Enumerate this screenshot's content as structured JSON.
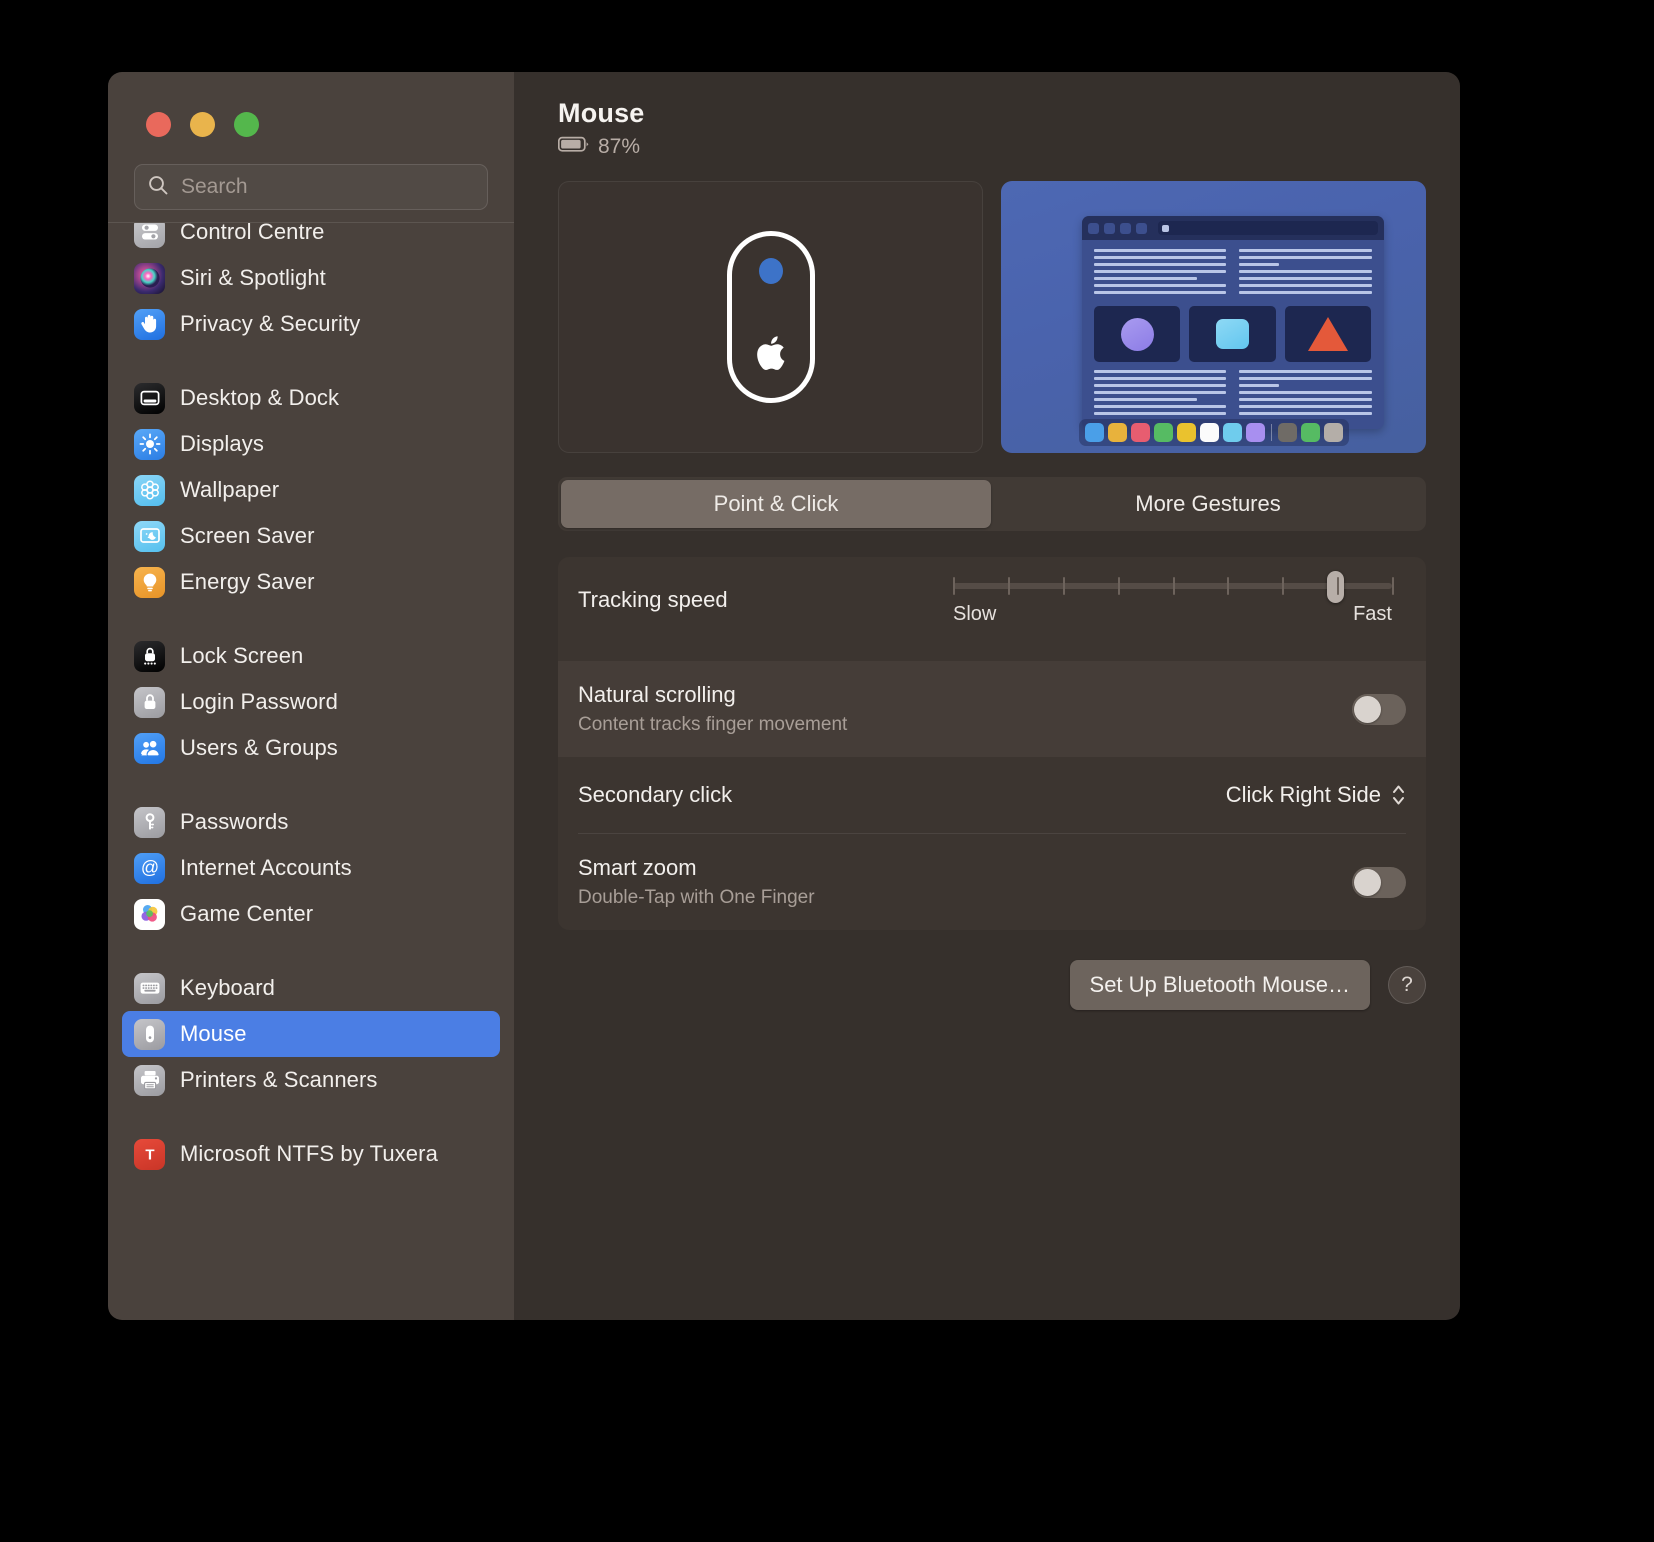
{
  "window": {
    "traffic_lights": [
      "close",
      "minimize",
      "zoom"
    ],
    "colors": {
      "accent": "#4b7ee4",
      "sidebar_bg": "#4a423d",
      "main_bg": "#36302c",
      "card_bg": "#3c3530",
      "close": "#e9695c",
      "minimize": "#e9b44c",
      "maximize": "#54b74c"
    }
  },
  "search": {
    "placeholder": "Search",
    "value": ""
  },
  "sidebar": {
    "groups": [
      {
        "items": [
          {
            "label": "Control Centre",
            "icon": "control-centre-icon",
            "selected": false
          },
          {
            "label": "Siri & Spotlight",
            "icon": "siri-icon",
            "selected": false
          },
          {
            "label": "Privacy & Security",
            "icon": "privacy-security-icon",
            "selected": false
          }
        ]
      },
      {
        "items": [
          {
            "label": "Desktop & Dock",
            "icon": "desktop-dock-icon",
            "selected": false
          },
          {
            "label": "Displays",
            "icon": "displays-icon",
            "selected": false
          },
          {
            "label": "Wallpaper",
            "icon": "wallpaper-icon",
            "selected": false
          },
          {
            "label": "Screen Saver",
            "icon": "screen-saver-icon",
            "selected": false
          },
          {
            "label": "Energy Saver",
            "icon": "energy-saver-icon",
            "selected": false
          }
        ]
      },
      {
        "items": [
          {
            "label": "Lock Screen",
            "icon": "lock-screen-icon",
            "selected": false
          },
          {
            "label": "Login Password",
            "icon": "login-password-icon",
            "selected": false
          },
          {
            "label": "Users & Groups",
            "icon": "users-groups-icon",
            "selected": false
          }
        ]
      },
      {
        "items": [
          {
            "label": "Passwords",
            "icon": "passwords-icon",
            "selected": false
          },
          {
            "label": "Internet Accounts",
            "icon": "internet-accounts-icon",
            "selected": false
          },
          {
            "label": "Game Center",
            "icon": "game-center-icon",
            "selected": false
          }
        ]
      },
      {
        "items": [
          {
            "label": "Keyboard",
            "icon": "keyboard-icon",
            "selected": false
          },
          {
            "label": "Mouse",
            "icon": "mouse-icon",
            "selected": true
          },
          {
            "label": "Printers & Scanners",
            "icon": "printers-scanners-icon",
            "selected": false
          }
        ]
      },
      {
        "items": [
          {
            "label": "Microsoft NTFS by Tuxera",
            "icon": "tuxera-ntfs-icon",
            "selected": false
          }
        ]
      }
    ]
  },
  "main": {
    "title": "Mouse",
    "battery_percent": "87%",
    "battery_level": 87,
    "previews": {
      "mouse_label": "magic-mouse-illustration",
      "desktop_label": "desktop-gesture-preview",
      "dock_colors": [
        "#4a9fe8",
        "#e8b23c",
        "#e75d70",
        "#56bb63",
        "#eac22e",
        "#fbfbfb",
        "#6fcced",
        "#a88ff0",
        "#6f6b66",
        "#56bb63",
        "#b4aea8"
      ]
    },
    "tabs": [
      {
        "label": "Point & Click",
        "active": true
      },
      {
        "label": "More Gestures",
        "active": false
      }
    ],
    "settings": {
      "tracking_speed": {
        "label": "Tracking speed",
        "min_label": "Slow",
        "max_label": "Fast",
        "ticks": 9,
        "value_percent": 87
      },
      "natural_scrolling": {
        "label": "Natural scrolling",
        "sublabel": "Content tracks finger movement",
        "on": false
      },
      "secondary_click": {
        "label": "Secondary click",
        "value": "Click Right Side"
      },
      "smart_zoom": {
        "label": "Smart zoom",
        "sublabel": "Double-Tap with One Finger",
        "on": false
      }
    },
    "footer": {
      "setup_button": "Set Up Bluetooth Mouse…",
      "help_button": "?"
    }
  }
}
